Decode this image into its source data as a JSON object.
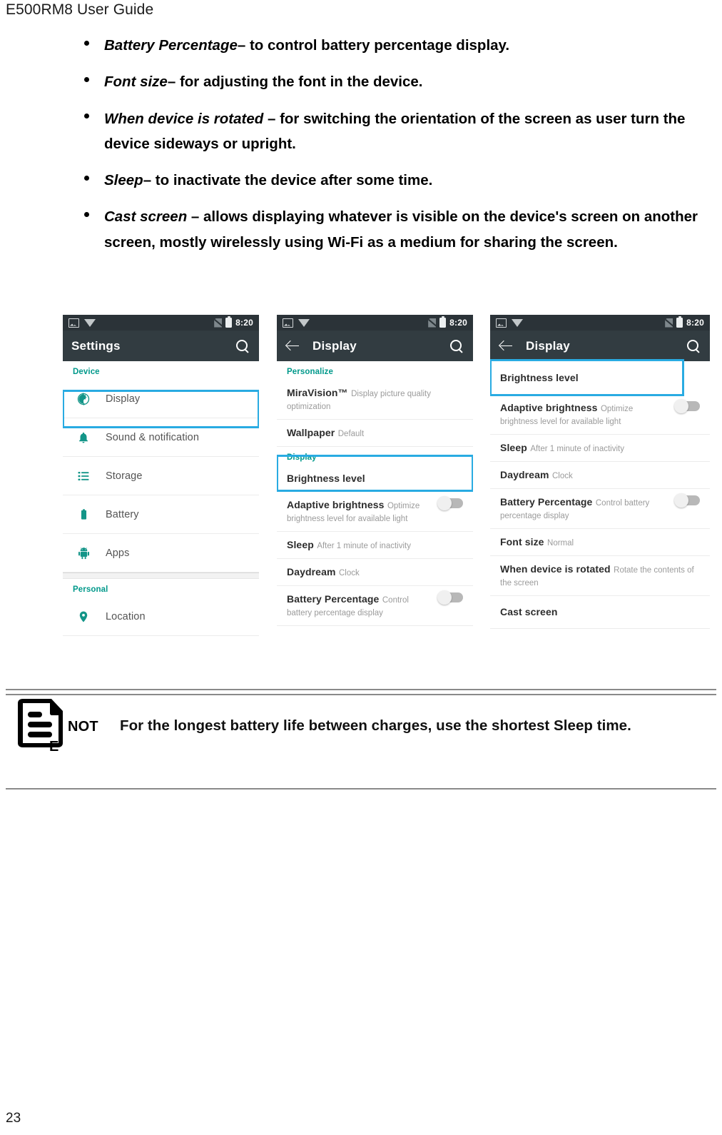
{
  "document": {
    "header_title": "E500RM8 User Guide",
    "page_number": "23"
  },
  "bullets": [
    {
      "term": "Battery Percentage",
      "rest": "– to control battery percentage display."
    },
    {
      "term": "Font size",
      "rest": "– for adjusting the font in the device."
    },
    {
      "term": "When device is rotated",
      "rest": " – for switching the orientation of the screen as user turn the device sideways or upright."
    },
    {
      "term": "Sleep",
      "rest": "– to inactivate the device after some time."
    },
    {
      "term": "Cast screen",
      "rest": " – allows displaying whatever is visible on the device's screen on another screen, mostly wirelessly using Wi-Fi as a medium for sharing the screen."
    }
  ],
  "colors": {
    "accent_teal": "#139588",
    "section_teal": "#01998b",
    "highlight_blue": "#29abe2",
    "appbar_dark": "#323c41",
    "statusbar_dark": "#2b3338"
  },
  "screenshots": {
    "status": {
      "time": "8:20",
      "icons": [
        "screenshot-icon",
        "wifi-icon",
        "no-sim-icon",
        "battery-icon"
      ]
    },
    "phone1": {
      "appbar": {
        "title": "Settings",
        "search_icon": "search-icon"
      },
      "sections": [
        {
          "label": "Device",
          "rows": [
            {
              "icon": "brightness-icon",
              "primary": "Display",
              "highlighted": true
            },
            {
              "icon": "bell-icon",
              "primary": "Sound & notification"
            },
            {
              "icon": "storage-list-icon",
              "primary": "Storage"
            },
            {
              "icon": "battery-icon",
              "primary": "Battery"
            },
            {
              "icon": "android-apps-icon",
              "primary": "Apps"
            }
          ]
        },
        {
          "label": "Personal",
          "rows": [
            {
              "icon": "location-pin-icon",
              "primary": "Location"
            }
          ]
        }
      ]
    },
    "phone2": {
      "appbar": {
        "title": "Display",
        "back_icon": "back-arrow-icon",
        "search_icon": "search-icon"
      },
      "sections": [
        {
          "label": "Personalize",
          "rows": [
            {
              "primary": "MiraVision™",
              "secondary": "Display picture quality optimization"
            },
            {
              "primary": "Wallpaper",
              "secondary": "Default"
            }
          ]
        },
        {
          "label": "Display",
          "highlighted": true,
          "rows": [
            {
              "primary": "Brightness level",
              "highlighted": true
            },
            {
              "primary": "Adaptive brightness",
              "secondary": "Optimize brightness level for available light",
              "toggle": "off"
            },
            {
              "primary": "Sleep",
              "secondary": "After 1 minute of inactivity"
            },
            {
              "primary": "Daydream",
              "secondary": "Clock"
            },
            {
              "primary": "Battery Percentage",
              "secondary": "Control battery percentage display",
              "toggle": "off"
            }
          ]
        }
      ]
    },
    "phone3": {
      "appbar": {
        "title": "Display",
        "back_icon": "back-arrow-icon",
        "search_icon": "search-icon"
      },
      "rows": [
        {
          "primary": "Brightness level",
          "highlighted": true
        },
        {
          "primary": "Adaptive brightness",
          "secondary": "Optimize brightness level for available light",
          "toggle": "off"
        },
        {
          "primary": "Sleep",
          "secondary": "After 1 minute of inactivity"
        },
        {
          "primary": "Daydream",
          "secondary": "Clock"
        },
        {
          "primary": "Battery Percentage",
          "secondary": "Control battery percentage display",
          "toggle": "off"
        },
        {
          "primary": "Font size",
          "secondary": "Normal"
        },
        {
          "primary": "When device is rotated",
          "secondary": "Rotate the contents of the screen"
        },
        {
          "primary": "Cast screen"
        }
      ]
    }
  },
  "note": {
    "icon": "note-document-icon",
    "label_line1": "NOT",
    "label_line2": "E",
    "text": "For the longest battery life between charges, use the shortest Sleep time."
  }
}
